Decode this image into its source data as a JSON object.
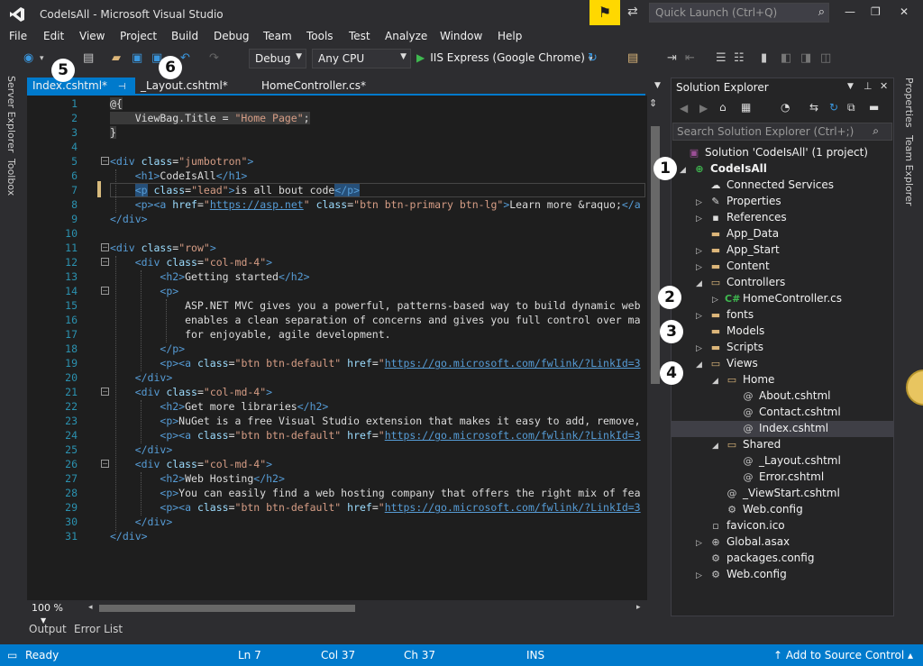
{
  "window": {
    "title": "CodeIsAll - Microsoft Visual Studio",
    "quick_launch_placeholder": "Quick Launch (Ctrl+Q)",
    "min": "—",
    "max": "❐",
    "close": "✕"
  },
  "menu": [
    "File",
    "Edit",
    "View",
    "Project",
    "Build",
    "Debug",
    "Team",
    "Tools",
    "Test",
    "Analyze",
    "Window",
    "Help"
  ],
  "toolbar": {
    "config": "Debug",
    "platform": "Any CPU",
    "run_label": "IIS Express (Google Chrome)"
  },
  "tabs": [
    "Index.cshtml*",
    "_Layout.cshtml*",
    "HomeController.cs*"
  ],
  "editor": {
    "lines": [
      "1",
      "2",
      "3",
      "4",
      "5",
      "6",
      "7",
      "8",
      "9",
      "10",
      "11",
      "12",
      "13",
      "14",
      "15",
      "16",
      "17",
      "18",
      "19",
      "20",
      "21",
      "22",
      "23",
      "24",
      "25",
      "26",
      "27",
      "28",
      "29",
      "30",
      "31"
    ],
    "zoom": "100 %"
  },
  "solution_explorer": {
    "title": "Solution Explorer",
    "search_placeholder": "Search Solution Explorer (Ctrl+;)",
    "solution": "Solution 'CodeIsAll' (1 project)",
    "project": "CodeIsAll",
    "items": [
      "Connected Services",
      "Properties",
      "References",
      "App_Data",
      "App_Start",
      "Content",
      "Controllers",
      "HomeController.cs",
      "fonts",
      "Models",
      "Scripts",
      "Views",
      "Home",
      "About.cshtml",
      "Contact.cshtml",
      "Index.cshtml",
      "Shared",
      "_Layout.cshtml",
      "Error.cshtml",
      "_ViewStart.cshtml",
      "Web.config",
      "favicon.ico",
      "Global.asax",
      "packages.config",
      "Web.config"
    ]
  },
  "side_tabs": {
    "left": [
      "Server Explorer",
      "Toolbox"
    ],
    "right": [
      "Properties",
      "Team Explorer"
    ]
  },
  "bottom_tabs": [
    "Output",
    "Error List"
  ],
  "status": {
    "ready": "Ready",
    "ln": "Ln 7",
    "col": "Col 37",
    "ch": "Ch 37",
    "ins": "INS",
    "source_control": "Add to Source Control"
  },
  "callouts": [
    "1",
    "2",
    "3",
    "4",
    "5",
    "6"
  ],
  "colors": {
    "accent": "#007acc",
    "background": "#1e1e1e"
  }
}
